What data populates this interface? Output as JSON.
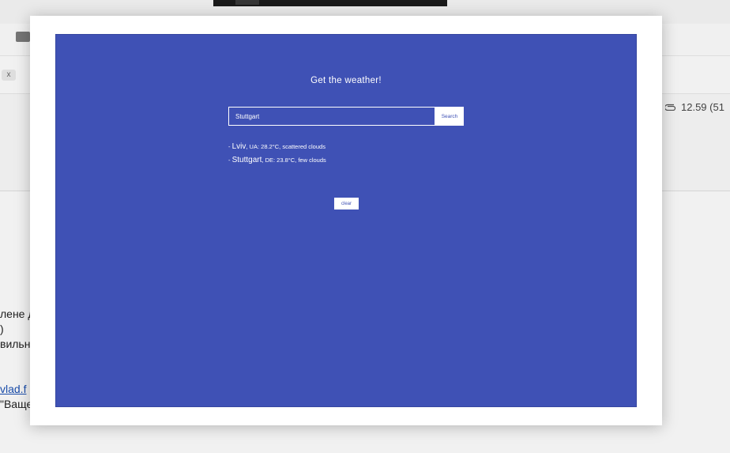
{
  "background": {
    "chip_label": "x",
    "attachment_info": "12.59 (51",
    "text_lines": [
      "лене д",
      ")",
      "вильн",
      "vlad.f",
      "\"Ваще"
    ]
  },
  "app": {
    "title": "Get the weather!",
    "search": {
      "value": "Stuttgart",
      "button_label": "Search"
    },
    "results": [
      {
        "prefix": "- ",
        "city": "Lviv",
        "details": ", UA: 28.2°C, scattered clouds"
      },
      {
        "prefix": "- ",
        "city": "Stuttgart",
        "details": ", DE: 23.8°C, few clouds"
      }
    ],
    "clear_label": "clear"
  },
  "colors": {
    "frame_bg": "#3f51b5",
    "text": "#ffffff",
    "button_bg": "#ffffff",
    "button_text": "#3f51b5"
  },
  "icons": {
    "attachment": "paperclip-icon",
    "folder": "folder-icon"
  }
}
